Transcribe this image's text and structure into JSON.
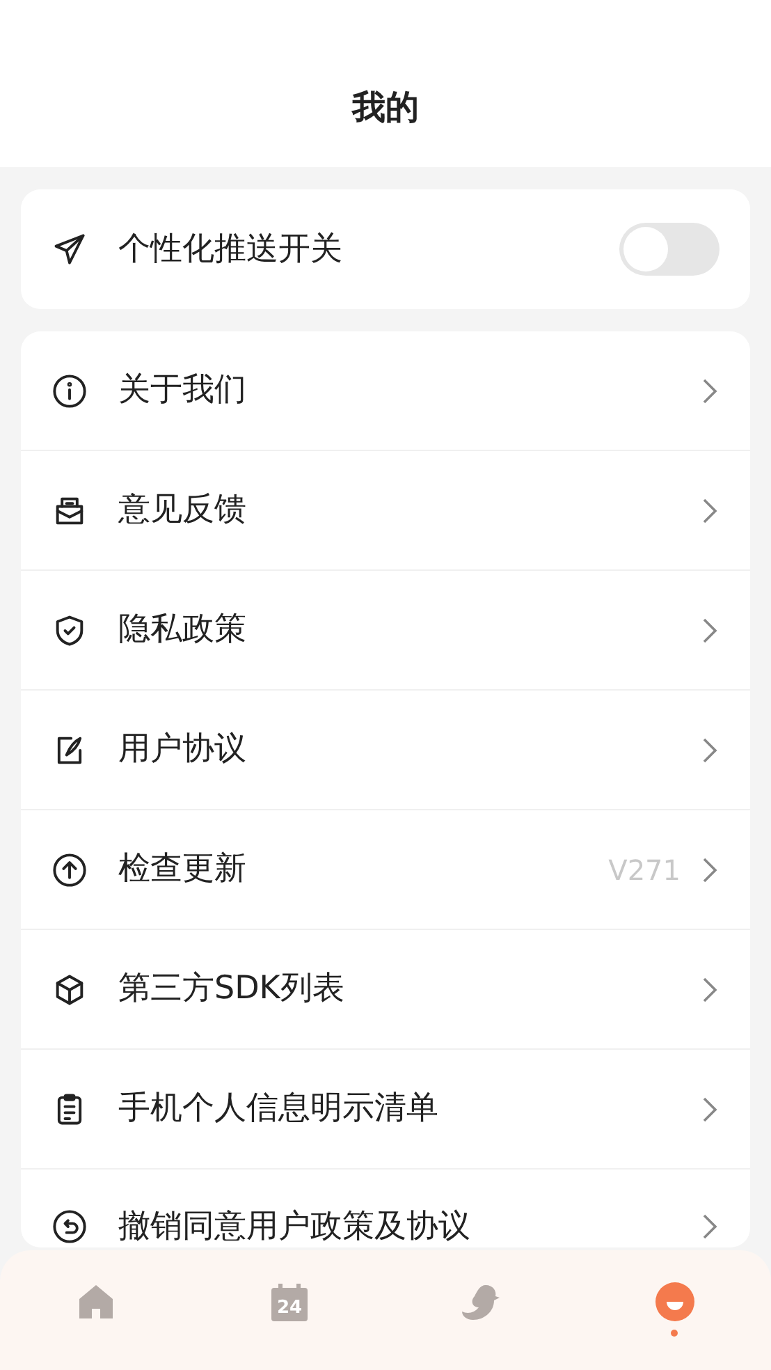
{
  "header": {
    "title": "我的"
  },
  "push_setting": {
    "label": "个性化推送开关",
    "on": false
  },
  "menu_items": [
    {
      "kind": "info",
      "label": "关于我们"
    },
    {
      "kind": "feedback",
      "label": "意见反馈"
    },
    {
      "kind": "privacy",
      "label": "隐私政策"
    },
    {
      "kind": "agreement",
      "label": "用户协议"
    },
    {
      "kind": "update",
      "label": "检查更新",
      "value": "V271"
    },
    {
      "kind": "sdk",
      "label": "第三方SDK列表"
    },
    {
      "kind": "list",
      "label": "手机个人信息明示清单"
    },
    {
      "kind": "revoke",
      "label": "撤销同意用户政策及协议"
    }
  ],
  "tab_bar": [
    {
      "kind": "home",
      "selected": false
    },
    {
      "kind": "calendar",
      "icon_text": "24",
      "selected": false
    },
    {
      "kind": "bird",
      "selected": false
    },
    {
      "kind": "me",
      "selected": true
    }
  ]
}
